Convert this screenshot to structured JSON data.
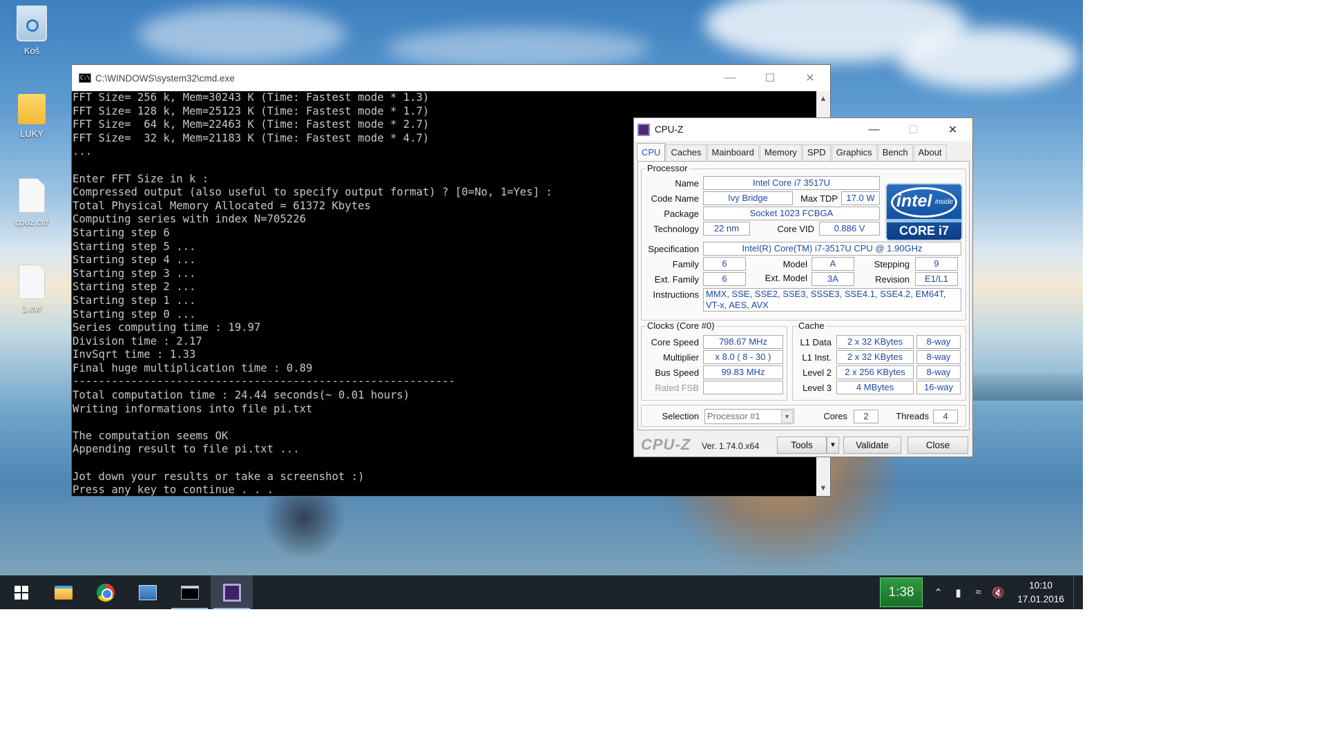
{
  "desktop": {
    "icons": [
      {
        "label": "Koš",
        "icon": "recycle-bin-icon"
      },
      {
        "label": "LUKY",
        "icon": "folder-icon"
      },
      {
        "label": "cpuz.cvf",
        "icon": "file-icon"
      },
      {
        "label": "1.cvf",
        "icon": "file-icon"
      }
    ]
  },
  "cmd": {
    "title": "C:\\WINDOWS\\system32\\cmd.exe",
    "icon_text": "C:\\",
    "lines": [
      "FFT Size= 256 k, Mem=30243 K (Time: Fastest mode * 1.3)",
      "FFT Size= 128 k, Mem=25123 K (Time: Fastest mode * 1.7)",
      "FFT Size=  64 k, Mem=22463 K (Time: Fastest mode * 2.7)",
      "FFT Size=  32 k, Mem=21183 K (Time: Fastest mode * 4.7)",
      "...",
      "",
      "Enter FFT Size in k :",
      "Compressed output (also useful to specify output format) ? [0=No, 1=Yes] :",
      "Total Physical Memory Allocated = 61372 Kbytes",
      "Computing series with index N=705226",
      "Starting step 6",
      "Starting step 5 ...",
      "Starting step 4 ...",
      "Starting step 3 ...",
      "Starting step 2 ...",
      "Starting step 1 ...",
      "Starting step 0 ...",
      "Series computing time : 19.97",
      "Division time : 2.17",
      "InvSqrt time : 1.33",
      "Final huge multiplication time : 0.89",
      "-----------------------------------------------------------",
      "Total computation time : 24.44 seconds(~ 0.01 hours)",
      "Writing informations into file pi.txt",
      "",
      "The computation seems OK",
      "Appending result to file pi.txt ...",
      "",
      "Jot down your results or take a screenshot :)",
      "Press any key to continue . . ."
    ]
  },
  "cpuz": {
    "title": "CPU-Z",
    "tabs": [
      "CPU",
      "Caches",
      "Mainboard",
      "Memory",
      "SPD",
      "Graphics",
      "Bench",
      "About"
    ],
    "active_tab": "CPU",
    "processor": {
      "legend": "Processor",
      "name_label": "Name",
      "name": "Intel Core i7 3517U",
      "codename_label": "Code Name",
      "codename": "Ivy Bridge",
      "maxtdp_label": "Max TDP",
      "maxtdp": "17.0 W",
      "package_label": "Package",
      "package": "Socket 1023 FCBGA",
      "technology_label": "Technology",
      "technology": "22 nm",
      "corevid_label": "Core VID",
      "corevid": "0.886 V",
      "spec_label": "Specification",
      "spec": "Intel(R) Core(TM) i7-3517U CPU @ 1.90GHz",
      "family_label": "Family",
      "family": "6",
      "model_label": "Model",
      "model": "A",
      "stepping_label": "Stepping",
      "stepping": "9",
      "extfamily_label": "Ext. Family",
      "extfamily": "6",
      "extmodel_label": "Ext. Model",
      "extmodel": "3A",
      "revision_label": "Revision",
      "revision": "E1/L1",
      "instructions_label": "Instructions",
      "instructions": "MMX, SSE, SSE2, SSE3, SSSE3, SSE4.1, SSE4.2, EM64T, VT-x, AES, AVX"
    },
    "intel_logo": {
      "word": "intel",
      "inside": "inside",
      "core": "CORE i7"
    },
    "clocks": {
      "legend": "Clocks (Core #0)",
      "corespeed_label": "Core Speed",
      "corespeed": "798.67 MHz",
      "multiplier_label": "Multiplier",
      "multiplier": "x 8.0 ( 8 - 30 )",
      "busspeed_label": "Bus Speed",
      "busspeed": "99.83 MHz",
      "ratedfsb_label": "Rated FSB",
      "ratedfsb": ""
    },
    "cache": {
      "legend": "Cache",
      "rows": [
        {
          "label": "L1 Data",
          "size": "2 x 32 KBytes",
          "way": "8-way"
        },
        {
          "label": "L1 Inst.",
          "size": "2 x 32 KBytes",
          "way": "8-way"
        },
        {
          "label": "Level 2",
          "size": "2 x 256 KBytes",
          "way": "8-way"
        },
        {
          "label": "Level 3",
          "size": "4 MBytes",
          "way": "16-way"
        }
      ]
    },
    "selection_label": "Selection",
    "selection": "Processor #1",
    "cores_label": "Cores",
    "cores": "2",
    "threads_label": "Threads",
    "threads": "4",
    "footer": {
      "brand": "CPU-Z",
      "version": "Ver. 1.74.0.x64",
      "tools": "Tools",
      "validate": "Validate",
      "close": "Close"
    }
  },
  "taskbar": {
    "timer": "1:38",
    "time": "10:10",
    "date": "17.01.2016"
  }
}
